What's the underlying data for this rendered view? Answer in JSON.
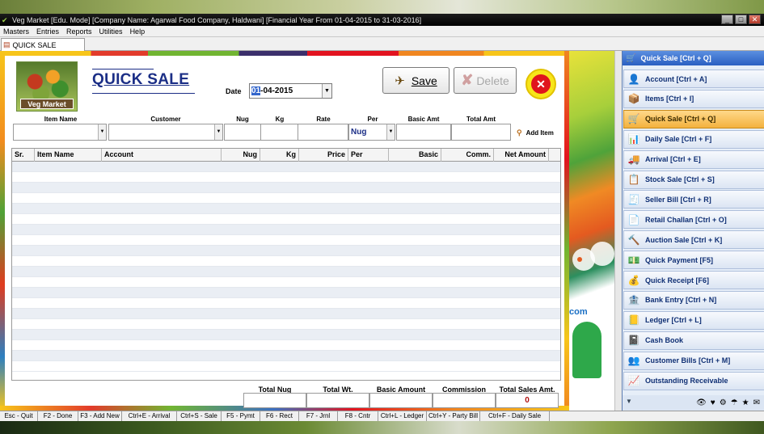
{
  "window": {
    "title": "Veg Market [Edu. Mode] [Company Name: Agarwal Food Company, Haldwani] [Financial Year From 01-04-2015 to 31-03-2016]",
    "controls": [
      "_",
      "□",
      "✕"
    ]
  },
  "menu": [
    "Masters",
    "Entries",
    "Reports",
    "Utilities",
    "Help"
  ],
  "tab": {
    "label": "QUICK SALE"
  },
  "form": {
    "logo_text": "Veg Market",
    "title": "QUICK SALE",
    "date_label": "Date",
    "date_selected": "01",
    "date_rest": "-04-2015",
    "save_label": "Save",
    "delete_label": "Delete"
  },
  "entry": {
    "headers": [
      "Item Name",
      "Customer",
      "Nug",
      "Kg",
      "Rate",
      "Per",
      "Basic Amt",
      "Total Amt"
    ],
    "per_value": "Nug",
    "add_item_label": "Add Item"
  },
  "grid": {
    "columns": [
      "Sr.",
      "Item Name",
      "Account",
      "Nug",
      "Kg",
      "Price",
      "Per",
      "Basic",
      "Comm.",
      "Net Amount"
    ],
    "rows": []
  },
  "totals": {
    "headers": [
      "Total Nug",
      "Total Wt.",
      "Basic Amount",
      "Commission",
      "Total Sales Amt."
    ],
    "total_sales_amt": "0"
  },
  "side_panel": {
    "header": "Quick Sale [Ctrl + Q]",
    "items": [
      {
        "label": "Account [Ctrl + A]",
        "icon": "👤"
      },
      {
        "label": "Items [Ctrl + I]",
        "icon": "📦"
      },
      {
        "label": "Quick Sale [Ctrl + Q]",
        "icon": "🛒",
        "active": true
      },
      {
        "label": "Daily Sale [Ctrl + F]",
        "icon": "📊"
      },
      {
        "label": "Arrival [Ctrl + E]",
        "icon": "🚚"
      },
      {
        "label": "Stock Sale [Ctrl + S]",
        "icon": "📋"
      },
      {
        "label": "Seller Bill [Ctrl + R]",
        "icon": "🧾"
      },
      {
        "label": "Retail Challan [Ctrl + O]",
        "icon": "📄"
      },
      {
        "label": "Auction Sale [Ctrl + K]",
        "icon": "🔨"
      },
      {
        "label": "Quick Payment [F5]",
        "icon": "💵"
      },
      {
        "label": "Quick Receipt [F6]",
        "icon": "💰"
      },
      {
        "label": "Bank Entry [Ctrl + N]",
        "icon": "🏦"
      },
      {
        "label": "Ledger [Ctrl + L]",
        "icon": "📒"
      },
      {
        "label": "Cash Book",
        "icon": "📓"
      },
      {
        "label": "Customer Bills [Ctrl + M]",
        "icon": "👥"
      },
      {
        "label": "Outstanding Receivable",
        "icon": "📈"
      }
    ],
    "footer_icons": [
      "👁",
      "♥",
      "⚙",
      "☂",
      "★",
      "✉"
    ]
  },
  "statusbar": [
    "Esc - Quit",
    "F2 - Done",
    "F3 - Add New",
    "Ctrl+E - Arrival",
    "Ctrl+S - Sale",
    "F5 - Pymt",
    "F6 - Rect",
    "F7 - Jrnl",
    "F8 - Cntr",
    "Ctrl+L - Ledger",
    "Ctrl+Y - Party Bill",
    "Ctrl+F - Daily Sale"
  ]
}
